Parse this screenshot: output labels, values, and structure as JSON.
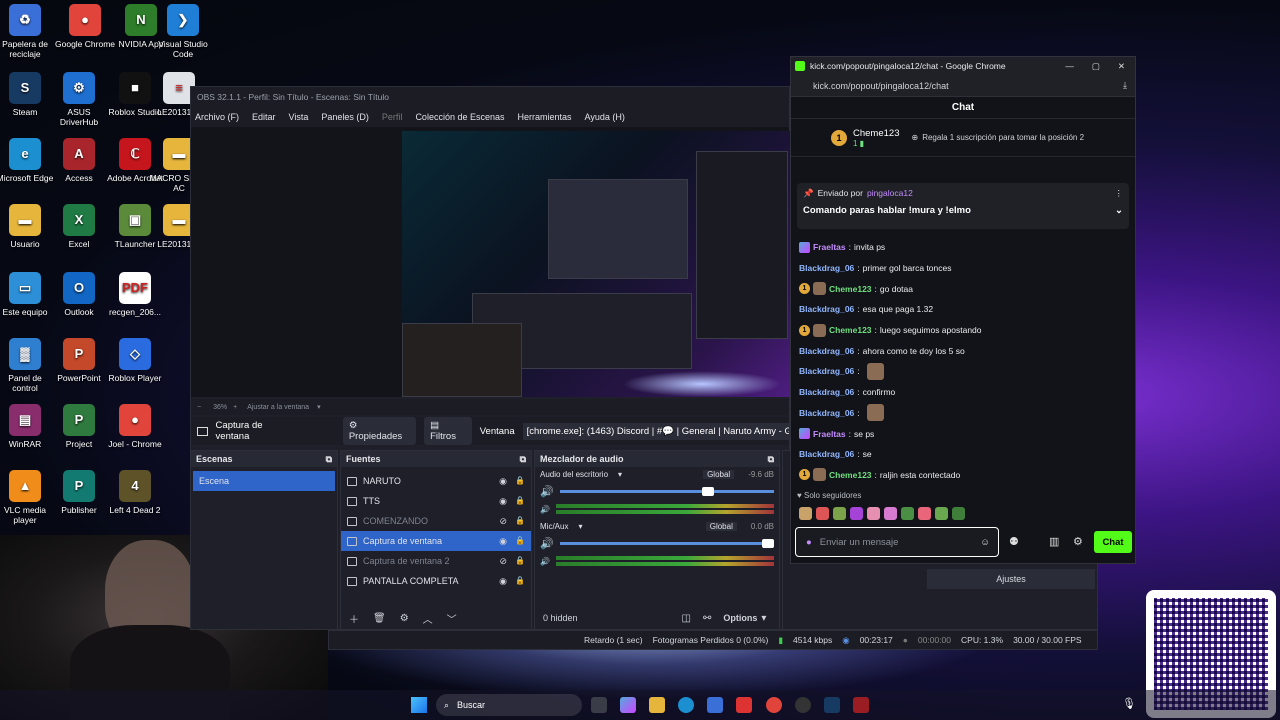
{
  "desktop_icons": [
    {
      "label": "Papelera de reciclaje",
      "color": "#3b6fd8",
      "glyph": "♻"
    },
    {
      "label": "Google Chrome",
      "color": "#e0443a",
      "glyph": "●"
    },
    {
      "label": "NVIDIA App",
      "color": "#2e7d2a",
      "glyph": "N"
    },
    {
      "label": "Visual Studio Code",
      "color": "#1f7ed6",
      "glyph": "❯"
    },
    {
      "label": "Steam",
      "color": "#173a63",
      "glyph": "S"
    },
    {
      "label": "ASUS DriverHub",
      "color": "#1e6fd0",
      "glyph": "⚙"
    },
    {
      "label": "Roblox Studio",
      "color": "#111111",
      "glyph": "■"
    },
    {
      "label": "LE2013137",
      "color": "#dfe2e6",
      "glyph": "≡"
    },
    {
      "label": "Microsoft Edge",
      "color": "#1b8fcf",
      "glyph": "e"
    },
    {
      "label": "Access",
      "color": "#a8262b",
      "glyph": "A"
    },
    {
      "label": "Adobe Acrobat",
      "color": "#c4161c",
      "glyph": "ℂ"
    },
    {
      "label": "MACRO SIRE - AC",
      "color": "#e6b53c",
      "glyph": "▬"
    },
    {
      "label": "Usuario",
      "color": "#e6b53c",
      "glyph": "▬"
    },
    {
      "label": "Excel",
      "color": "#1f7a44",
      "glyph": "X"
    },
    {
      "label": "TLauncher",
      "color": "#5b8a3a",
      "glyph": "▣"
    },
    {
      "label": "LE2013137",
      "color": "#e6b53c",
      "glyph": "▬"
    },
    {
      "label": "Este equipo",
      "color": "#2c8fd8",
      "glyph": "▭"
    },
    {
      "label": "Outlook",
      "color": "#1167c3",
      "glyph": "O"
    },
    {
      "label": "recgen_206...",
      "color": "#ffffff",
      "glyph": "PDF"
    },
    {
      "label": "Panel de control",
      "color": "#2f7fd1",
      "glyph": "▓"
    },
    {
      "label": "PowerPoint",
      "color": "#c4492a",
      "glyph": "P"
    },
    {
      "label": "Roblox Player",
      "color": "#2a6be0",
      "glyph": "◇"
    },
    {
      "label": "WinRAR",
      "color": "#8a2d6d",
      "glyph": "▤"
    },
    {
      "label": "Project",
      "color": "#2f7a3e",
      "glyph": "P"
    },
    {
      "label": "Joel - Chrome",
      "color": "#e0443a",
      "glyph": "●"
    },
    {
      "label": "VLC media player",
      "color": "#f08c1a",
      "glyph": "▲"
    },
    {
      "label": "Publisher",
      "color": "#127a70",
      "glyph": "P"
    },
    {
      "label": "Left 4 Dead 2",
      "color": "#5d5228",
      "glyph": "4"
    }
  ],
  "obs": {
    "title": "OBS 32.1.1 - Perfil: Sin Título - Escenas: Sin Título",
    "menu": [
      "Archivo (F)",
      "Editar",
      "Vista",
      "Paneles (D)",
      "Perfil",
      "Colección de Escenas",
      "Herramientas",
      "Ayuda (H)"
    ],
    "zoom": "36%",
    "fit_label": "Ajustar a la ventana",
    "source_name": "Captura de ventana",
    "props": "Propiedades",
    "filters": "Filtros",
    "window_label": "Ventana",
    "window_value": "[chrome.exe]: (1463) Discord | #💬 | General | Naruto Army - Goog",
    "scenes": {
      "title": "Escenas",
      "items": [
        "Escena"
      ]
    },
    "sources": {
      "title": "Fuentes",
      "items": [
        {
          "label": "NARUTO",
          "dim": false,
          "sel": false
        },
        {
          "label": "TTS",
          "dim": false,
          "sel": false
        },
        {
          "label": "COMENZANDO",
          "dim": true,
          "sel": false
        },
        {
          "label": "Captura de ventana",
          "dim": false,
          "sel": true
        },
        {
          "label": "Captura de ventana 2",
          "dim": true,
          "sel": false
        },
        {
          "label": "PANTALLA COMPLETA",
          "dim": false,
          "sel": false
        }
      ]
    },
    "mixer": {
      "title": "Mezclador de audio",
      "channels": [
        {
          "name": "Audio del escritorio",
          "tag": "Global",
          "db": "-9.6 dB"
        },
        {
          "name": "Mic/Aux",
          "tag": "Global",
          "db": "0.0 dB"
        }
      ],
      "scale": [
        "-60",
        "-55",
        "-50",
        "-45",
        "-40",
        "-35",
        "-30",
        "-25",
        "-20",
        "-15",
        "-10",
        "-5",
        "0"
      ],
      "hidden": "0 hidden",
      "options": "Options"
    },
    "settings_label": "Ajustes",
    "status": {
      "delay": "Retardo (1 sec)",
      "dropped": "Fotogramas Perdidos 0 (0.0%)",
      "bitrate": "4514 kbps",
      "live_time": "00:23:17",
      "rec_time": "00:00:00",
      "cpu": "CPU: 1.3%",
      "fps": "30.00 / 30.00 FPS"
    }
  },
  "chrome": {
    "title": "kick.com/popout/pingaloca12/chat - Google Chrome",
    "url": "kick.com/popout/pingaloca12/chat",
    "chat_title": "Chat",
    "top_gifter": {
      "name": "Cheme123",
      "count": "1",
      "text": "Regala 1 suscripción para tomar la posición 2"
    },
    "pinned": {
      "sent_by": "Enviado por",
      "user": "pingaloca12",
      "text": "Comando paras hablar !mura y !elmo"
    },
    "messages": [
      {
        "user": "Fraeltas",
        "text": "invita ps",
        "color": "#c58cff",
        "badge": "kick",
        "emote": false
      },
      {
        "user": "Blackdrag_06",
        "text": "primer gol barca tonces",
        "color": "#8fb6ff",
        "badge": "",
        "emote": false
      },
      {
        "user": "Cheme123",
        "text": "go dotaa",
        "color": "#6ee07f",
        "badge": "sub",
        "emote": false
      },
      {
        "user": "Blackdrag_06",
        "text": "esa que paga 1.32",
        "color": "#8fb6ff",
        "badge": "",
        "emote": false
      },
      {
        "user": "Cheme123",
        "text": "luego seguimos apostando",
        "color": "#6ee07f",
        "badge": "sub",
        "emote": false
      },
      {
        "user": "Blackdrag_06",
        "text": "ahora como te doy los 5 so",
        "color": "#8fb6ff",
        "badge": "",
        "emote": false
      },
      {
        "user": "Blackdrag_06",
        "text": "",
        "color": "#8fb6ff",
        "badge": "",
        "emote": true
      },
      {
        "user": "Blackdrag_06",
        "text": "confirmo",
        "color": "#8fb6ff",
        "badge": "",
        "emote": false
      },
      {
        "user": "Blackdrag_06",
        "text": "",
        "color": "#8fb6ff",
        "badge": "",
        "emote": true
      },
      {
        "user": "Fraeltas",
        "text": "se ps",
        "color": "#c58cff",
        "badge": "kick",
        "emote": false
      },
      {
        "user": "Blackdrag_06",
        "text": "se",
        "color": "#8fb6ff",
        "badge": "",
        "emote": false
      },
      {
        "user": "Cheme123",
        "text": "raljin esta contectado",
        "color": "#6ee07f",
        "badge": "sub",
        "emote": false
      }
    ],
    "followers_only": "Solo seguidores",
    "placeholder": "Enviar un mensaje",
    "chat_button": "Chat"
  },
  "taskbar": {
    "search": "Buscar"
  }
}
